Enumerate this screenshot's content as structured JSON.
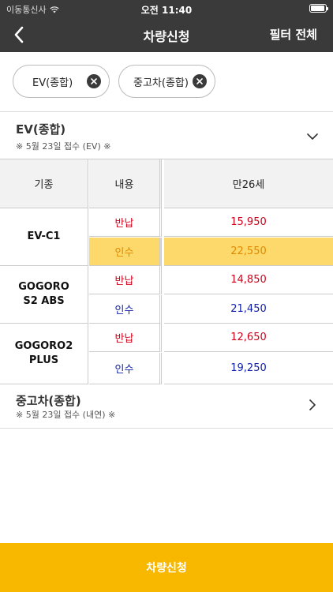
{
  "status": {
    "carrier": "이동통신사",
    "time": "오전 11:40"
  },
  "nav": {
    "title": "차량신청",
    "filter_all": "필터 전체"
  },
  "chips": [
    {
      "label": "EV(종합)"
    },
    {
      "label": "중고차(종합)"
    }
  ],
  "sections": {
    "ev": {
      "title": "EV(종합)",
      "subtitle": "※ 5월 23일 접수 (EV) ※"
    },
    "used": {
      "title": "중고차(종합)",
      "subtitle": "※ 5월 23일 접수 (내연) ※"
    }
  },
  "table": {
    "headers": {
      "model": "기종",
      "type": "내용",
      "age": "만26세"
    },
    "models": [
      {
        "name": "EV-C1",
        "rows": [
          {
            "type": "반납",
            "price": "15,950"
          },
          {
            "type": "인수",
            "price": "22,550"
          }
        ]
      },
      {
        "name": "GOGORO\nS2 ABS",
        "rows": [
          {
            "type": "반납",
            "price": "14,850"
          },
          {
            "type": "인수",
            "price": "21,450"
          }
        ]
      },
      {
        "name": "GOGORO2\nPLUS",
        "rows": [
          {
            "type": "반납",
            "price": "12,650"
          },
          {
            "type": "인수",
            "price": "19,250"
          }
        ]
      }
    ]
  },
  "apply_button": "차량신청",
  "colors": {
    "header_bg": "#3a3a3a",
    "accent": "#f9b800",
    "highlight": "#fcd96a",
    "return_red": "#d0021b",
    "acquire_blue": "#1020a8"
  }
}
